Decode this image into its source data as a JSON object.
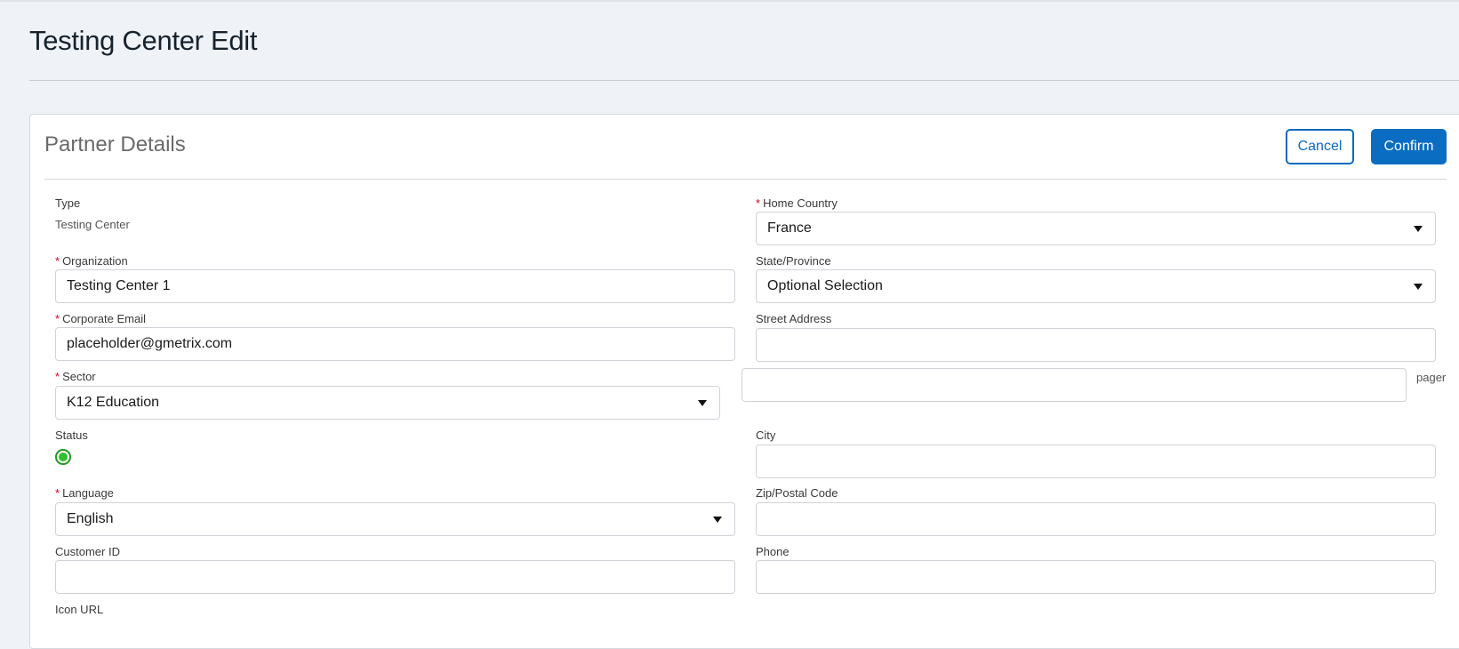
{
  "page": {
    "title": "Testing Center Edit"
  },
  "card": {
    "title": "Partner Details",
    "cancel_label": "Cancel",
    "confirm_label": "Confirm"
  },
  "left": {
    "type_label": "Type",
    "type_value": "Testing Center",
    "organization_label": "Organization",
    "organization_value": "Testing Center 1",
    "email_label": "Corporate Email",
    "email_value": "placeholder@gmetrix.com",
    "sector_label": "Sector",
    "sector_value": "K12 Education",
    "status_label": "Status",
    "language_label": "Language",
    "language_value": "English",
    "customer_id_label": "Customer ID",
    "customer_id_value": "",
    "icon_url_label": "Icon URL"
  },
  "right": {
    "home_country_label": "Home Country",
    "home_country_value": "France",
    "state_label": "State/Province",
    "state_value": "Optional Selection",
    "street_label": "Street Address",
    "street_value": "",
    "street2_value": "",
    "pager_label": "pager",
    "city_label": "City",
    "city_value": "",
    "zip_label": "Zip/Postal Code",
    "zip_value": "",
    "phone_label": "Phone",
    "phone_value": ""
  },
  "required_marker": "*",
  "colors": {
    "accent": "#0a6dc2",
    "required": "#d0021b",
    "status_active": "#2fbf2f"
  }
}
